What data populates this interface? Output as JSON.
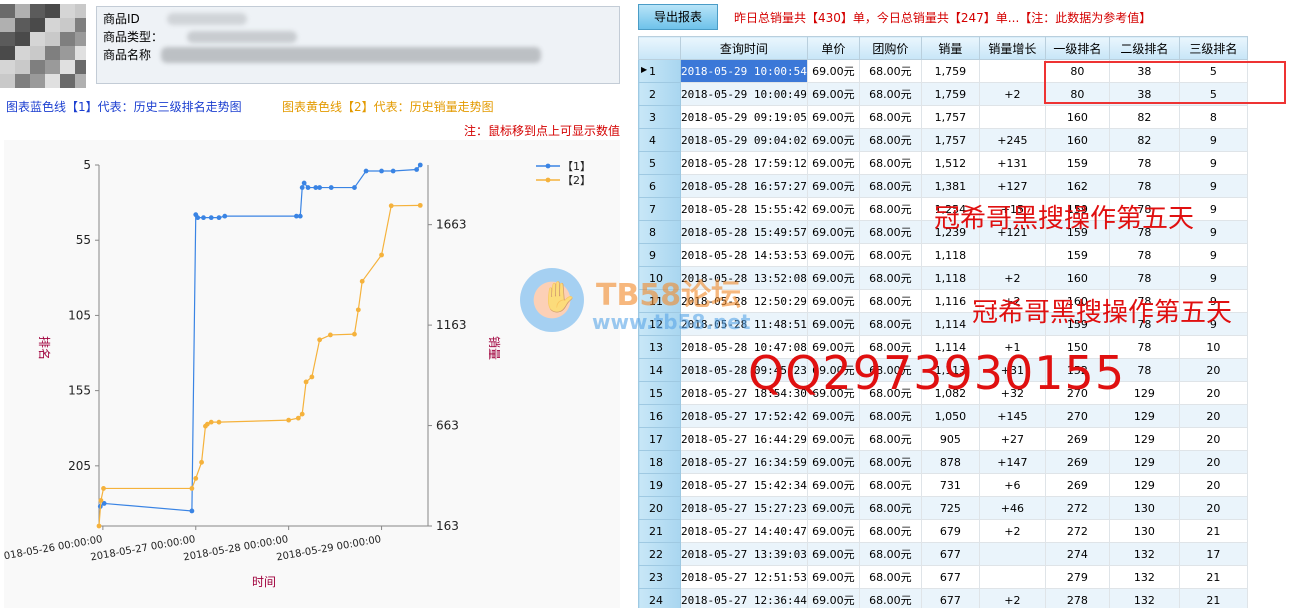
{
  "product": {
    "id_label": "商品ID",
    "type_label": "商品类型：",
    "name_label": "商品名称"
  },
  "legend_notes": {
    "blue": "图表蓝色线【1】代表：历史三级排名走势图",
    "yellow": "图表黄色线【2】代表：历史销量走势图"
  },
  "hint": "注：鼠标移到点上可显示数值",
  "toolbar": {
    "export_label": "导出报表",
    "summary": "昨日总销量共【430】单，今日总销量共【247】单...【注：此数据为参考值】"
  },
  "colors": {
    "rank_line": "#3a84e4",
    "sales_line": "#f5b23c",
    "accent_red": "#d40000",
    "axis_label": "#a0003c"
  },
  "chart_data": {
    "type": "line",
    "xlabel": "时间",
    "ylabel_left": "排名",
    "ylabel_right": "销量",
    "x_ticks": [
      "2018-05-26 00:00:00",
      "2018-05-27 00:00:00",
      "2018-05-28 00:00:00",
      "2018-05-29 00:00:00"
    ],
    "y_left_ticks": [
      5,
      55,
      105,
      155,
      205
    ],
    "y_left_range": [
      5,
      245
    ],
    "y_right_ticks": [
      163,
      663,
      1163,
      1663
    ],
    "y_right_range": [
      163,
      1960
    ],
    "x_range": [
      "2018-05-25 23:00",
      "2018-05-29 12:00"
    ],
    "legend": [
      "【1】",
      "【2】"
    ],
    "legend_placement": "top-right",
    "series": [
      {
        "name": "【1】",
        "x": [
          "2018-05-25 23:20",
          "2018-05-26 00:20",
          "2018-05-26 23:00",
          "2018-05-27 00:00",
          "2018-05-27 00:30",
          "2018-05-27 02:00",
          "2018-05-27 04:00",
          "2018-05-27 06:00",
          "2018-05-27 07:30",
          "2018-05-28 02:00",
          "2018-05-28 03:00",
          "2018-05-28 03:30",
          "2018-05-28 04:00",
          "2018-05-28 05:00",
          "2018-05-28 07:00",
          "2018-05-28 08:00",
          "2018-05-28 11:00",
          "2018-05-28 17:00",
          "2018-05-28 20:00",
          "2018-05-29 00:00",
          "2018-05-29 03:00",
          "2018-05-29 09:04",
          "2018-05-29 10:00"
        ],
        "y": [
          232,
          230,
          235,
          38,
          40,
          40,
          40,
          40,
          39,
          39,
          39,
          20,
          17,
          20,
          20,
          20,
          20,
          20,
          9,
          9,
          9,
          8,
          5
        ]
      },
      {
        "name": "【2】",
        "x": [
          "2018-05-25 23:00",
          "2018-05-25 23:30",
          "2018-05-26 00:10",
          "2018-05-26 23:00",
          "2018-05-27 00:00",
          "2018-05-27 01:30",
          "2018-05-27 02:30",
          "2018-05-27 03:00",
          "2018-05-27 04:00",
          "2018-05-27 06:00",
          "2018-05-28 00:00",
          "2018-05-28 02:30",
          "2018-05-28 03:30",
          "2018-05-28 04:30",
          "2018-05-28 06:00",
          "2018-05-28 08:00",
          "2018-05-28 10:47",
          "2018-05-28 17:00",
          "2018-05-28 18:00",
          "2018-05-28 19:00",
          "2018-05-29 00:00",
          "2018-05-29 02:30",
          "2018-05-29 10:00"
        ],
        "y": [
          163,
          290,
          350,
          350,
          400,
          480,
          660,
          670,
          680,
          680,
          690,
          700,
          720,
          880,
          905,
          1090,
          1114,
          1118,
          1239,
          1381,
          1512,
          1757,
          1759
        ]
      }
    ]
  },
  "table": {
    "columns": [
      "查询时间",
      "单价",
      "团购价",
      "销量",
      "销量增长",
      "一级排名",
      "二级排名",
      "三级排名"
    ],
    "rows": [
      [
        "1",
        "2018-05-29 10:00:54",
        "69.00元",
        "68.00元",
        "1,759",
        "",
        "80",
        "38",
        "5"
      ],
      [
        "2",
        "2018-05-29 10:00:49",
        "69.00元",
        "68.00元",
        "1,759",
        "+2",
        "80",
        "38",
        "5"
      ],
      [
        "3",
        "2018-05-29 09:19:05",
        "69.00元",
        "68.00元",
        "1,757",
        "",
        "160",
        "82",
        "8"
      ],
      [
        "4",
        "2018-05-29 09:04:02",
        "69.00元",
        "68.00元",
        "1,757",
        "+245",
        "160",
        "82",
        "9"
      ],
      [
        "5",
        "2018-05-28 17:59:12",
        "69.00元",
        "68.00元",
        "1,512",
        "+131",
        "159",
        "78",
        "9"
      ],
      [
        "6",
        "2018-05-28 16:57:27",
        "69.00元",
        "68.00元",
        "1,381",
        "+127",
        "162",
        "78",
        "9"
      ],
      [
        "7",
        "2018-05-28 15:55:42",
        "69.00元",
        "68.00元",
        "1,254",
        "+15",
        "159",
        "78",
        "9"
      ],
      [
        "8",
        "2018-05-28 15:49:57",
        "69.00元",
        "68.00元",
        "1,239",
        "+121",
        "159",
        "78",
        "9"
      ],
      [
        "9",
        "2018-05-28 14:53:53",
        "69.00元",
        "68.00元",
        "1,118",
        "",
        "159",
        "78",
        "9"
      ],
      [
        "10",
        "2018-05-28 13:52:08",
        "69.00元",
        "68.00元",
        "1,118",
        "+2",
        "160",
        "78",
        "9"
      ],
      [
        "11",
        "2018-05-28 12:50:29",
        "69.00元",
        "68.00元",
        "1,116",
        "+2",
        "160",
        "78",
        "9"
      ],
      [
        "12",
        "2018-05-28 11:48:51",
        "69.00元",
        "68.00元",
        "1,114",
        "",
        "159",
        "78",
        "9"
      ],
      [
        "13",
        "2018-05-28 10:47:08",
        "69.00元",
        "68.00元",
        "1,114",
        "+1",
        "150",
        "78",
        "10"
      ],
      [
        "14",
        "2018-05-28 09:45:23",
        "69.00元",
        "68.00元",
        "1,113",
        "+31",
        "152",
        "78",
        "20"
      ],
      [
        "15",
        "2018-05-27 18:54:30",
        "69.00元",
        "68.00元",
        "1,082",
        "+32",
        "270",
        "129",
        "20"
      ],
      [
        "16",
        "2018-05-27 17:52:42",
        "69.00元",
        "68.00元",
        "1,050",
        "+145",
        "270",
        "129",
        "20"
      ],
      [
        "17",
        "2018-05-27 16:44:29",
        "69.00元",
        "68.00元",
        "905",
        "+27",
        "269",
        "129",
        "20"
      ],
      [
        "18",
        "2018-05-27 16:34:59",
        "69.00元",
        "68.00元",
        "878",
        "+147",
        "269",
        "129",
        "20"
      ],
      [
        "19",
        "2018-05-27 15:42:34",
        "69.00元",
        "68.00元",
        "731",
        "+6",
        "269",
        "129",
        "20"
      ],
      [
        "20",
        "2018-05-27 15:27:23",
        "69.00元",
        "68.00元",
        "725",
        "+46",
        "272",
        "130",
        "20"
      ],
      [
        "21",
        "2018-05-27 14:40:47",
        "69.00元",
        "68.00元",
        "679",
        "+2",
        "272",
        "130",
        "21"
      ],
      [
        "22",
        "2018-05-27 13:39:03",
        "69.00元",
        "68.00元",
        "677",
        "",
        "274",
        "132",
        "17"
      ],
      [
        "23",
        "2018-05-27 12:51:53",
        "69.00元",
        "68.00元",
        "677",
        "",
        "279",
        "132",
        "21"
      ],
      [
        "24",
        "2018-05-27 12:36:44",
        "69.00元",
        "68.00元",
        "677",
        "+2",
        "278",
        "132",
        "21"
      ]
    ]
  },
  "watermarks": {
    "line1": "冠希哥黑搜操作第五天",
    "line2": "冠希哥黑搜操作第五天",
    "qq": "QQ2973930155",
    "logo_brand": "TB58论坛",
    "logo_url": "www.tb58.net"
  }
}
